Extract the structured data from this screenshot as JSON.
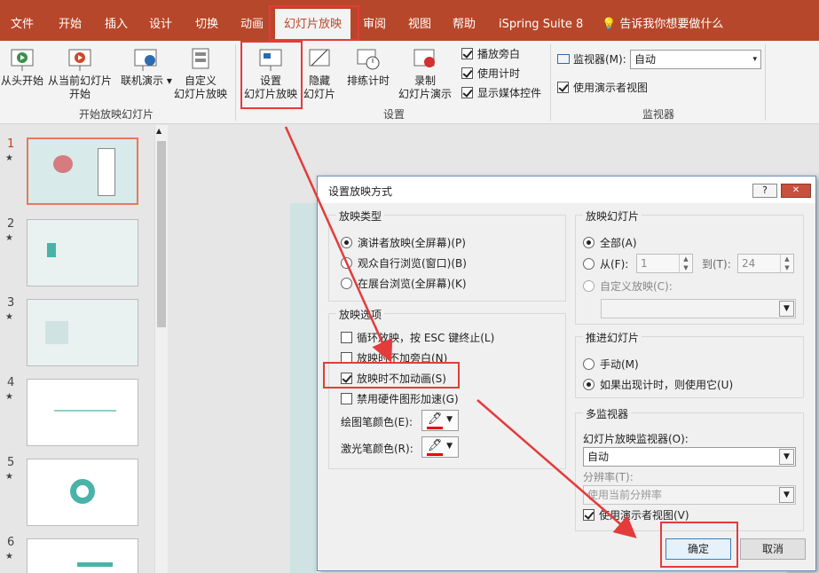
{
  "colors": {
    "accent": "#b7472a",
    "highlight": "#e43b3b",
    "selected_thumb_border": "#e9785a"
  },
  "tabs": [
    {
      "label": "文件"
    },
    {
      "label": "开始"
    },
    {
      "label": "插入"
    },
    {
      "label": "设计"
    },
    {
      "label": "切换"
    },
    {
      "label": "动画"
    },
    {
      "label": "幻灯片放映"
    },
    {
      "label": "审阅"
    },
    {
      "label": "视图"
    },
    {
      "label": "帮助"
    },
    {
      "label": "iSpring Suite 8"
    },
    {
      "label": "告诉我你想要做什么"
    }
  ],
  "ribbon": {
    "start_group": {
      "from_beginning": "从头开始",
      "from_current": "从当前幻灯片\n开始",
      "online": "联机演示",
      "custom": "自定义\n幻灯片放映",
      "label": "开始放映幻灯片"
    },
    "setup_group": {
      "setup_show": "设置\n幻灯片放映",
      "hide_slide": "隐藏\n幻灯片",
      "rehearse": "排练计时",
      "record": "录制\n幻灯片演示",
      "play_narrations": "播放旁白",
      "use_timings": "使用计时",
      "show_media_controls": "显示媒体控件",
      "label": "设置"
    },
    "monitor_group": {
      "monitor_label": "监视器(M):",
      "monitor_value": "自动",
      "presenter_view": "使用演示者视图",
      "label": "监视器"
    }
  },
  "slides": [
    {
      "number": "1",
      "star": "★"
    },
    {
      "number": "2",
      "star": "★"
    },
    {
      "number": "3",
      "star": "★"
    },
    {
      "number": "4",
      "star": "★"
    },
    {
      "number": "5",
      "star": "★"
    },
    {
      "number": "6",
      "star": "★"
    }
  ],
  "dialog": {
    "title": "设置放映方式",
    "help_button": "?",
    "close_button": "✕",
    "show_type": {
      "title": "放映类型",
      "presenter": "演讲者放映(全屏幕)(P)",
      "individual": "观众自行浏览(窗口)(B)",
      "kiosk": "在展台浏览(全屏幕)(K)"
    },
    "show_options": {
      "title": "放映选项",
      "loop": "循环放映，按 ESC 键终止(L)",
      "no_narration": "放映时不加旁白(N)",
      "no_animation": "放映时不加动画(S)",
      "no_hw_accel": "禁用硬件图形加速(G)",
      "pen_color": "绘图笔颜色(E):",
      "laser_color": "激光笔颜色(R):"
    },
    "show_slides": {
      "title": "放映幻灯片",
      "all": "全部(A)",
      "from": "从(F):",
      "from_value": "1",
      "to": "到(T):",
      "to_value": "24",
      "custom": "自定义放映(C):",
      "custom_value": ""
    },
    "advance": {
      "title": "推进幻灯片",
      "manual": "手动(M)",
      "timings": "如果出现计时，则使用它(U)"
    },
    "multi_monitor": {
      "title": "多监视器",
      "monitor_label": "幻灯片放映监视器(O):",
      "monitor_value": "自动",
      "resolution_label": "分辨率(T):",
      "resolution_value": "使用当前分辨率",
      "presenter_view": "使用演示者视图(V)"
    },
    "ok": "确定",
    "cancel": "取消"
  }
}
